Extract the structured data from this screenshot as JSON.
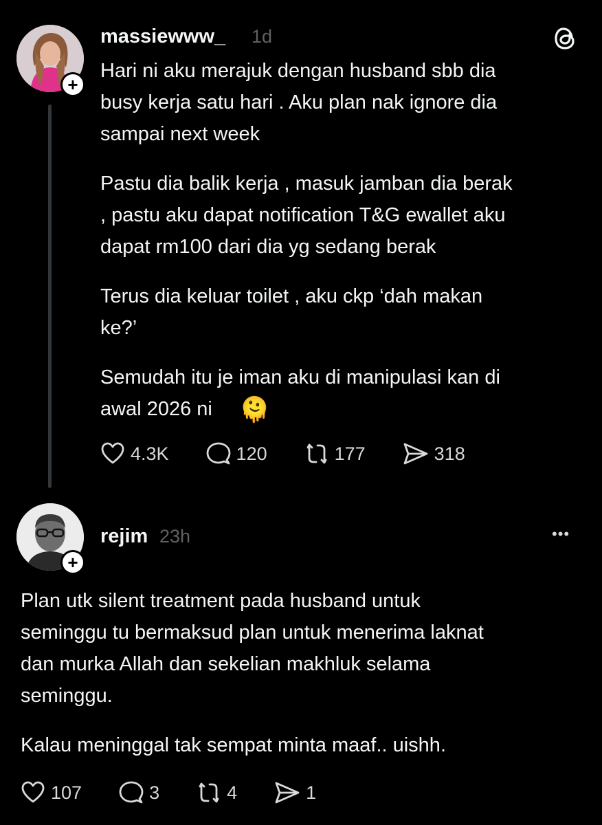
{
  "post": {
    "username": "massiewww_",
    "time": "1d",
    "paragraphs": [
      "Hari ni aku merajuk dengan husband sbb dia\nbusy kerja satu hari . Aku plan nak ignore dia\nsampai next week",
      "Pastu dia balik kerja , masuk jamban dia berak\n, pastu aku dapat notification T&G ewallet aku\ndapat rm100 dari dia yg sedang berak",
      "Terus dia keluar toilet , aku ckp ‘dah makan\nke?’",
      "Semudah itu je iman aku di manipulasi kan di\nawal 2026 ni"
    ],
    "emoji": "🫠",
    "likes": "4.3K",
    "comments": "120",
    "reposts": "177",
    "shares": "318"
  },
  "reply": {
    "username": "rejim",
    "time": "23h",
    "more": "•••",
    "paragraphs": [
      "Plan utk silent treatment pada husband untuk\nseminggu tu bermaksud plan untuk menerima laknat\ndan murka Allah dan sekelian makhluk selama\nseminggu.",
      "Kalau meninggal tak sempat minta maaf.. uishh."
    ],
    "likes": "107",
    "comments": "3",
    "reposts": "4",
    "shares": "1"
  },
  "colors": {
    "background": "#000000",
    "text": "#f3f5f7",
    "muted": "#616161",
    "thread_line": "#333639"
  }
}
